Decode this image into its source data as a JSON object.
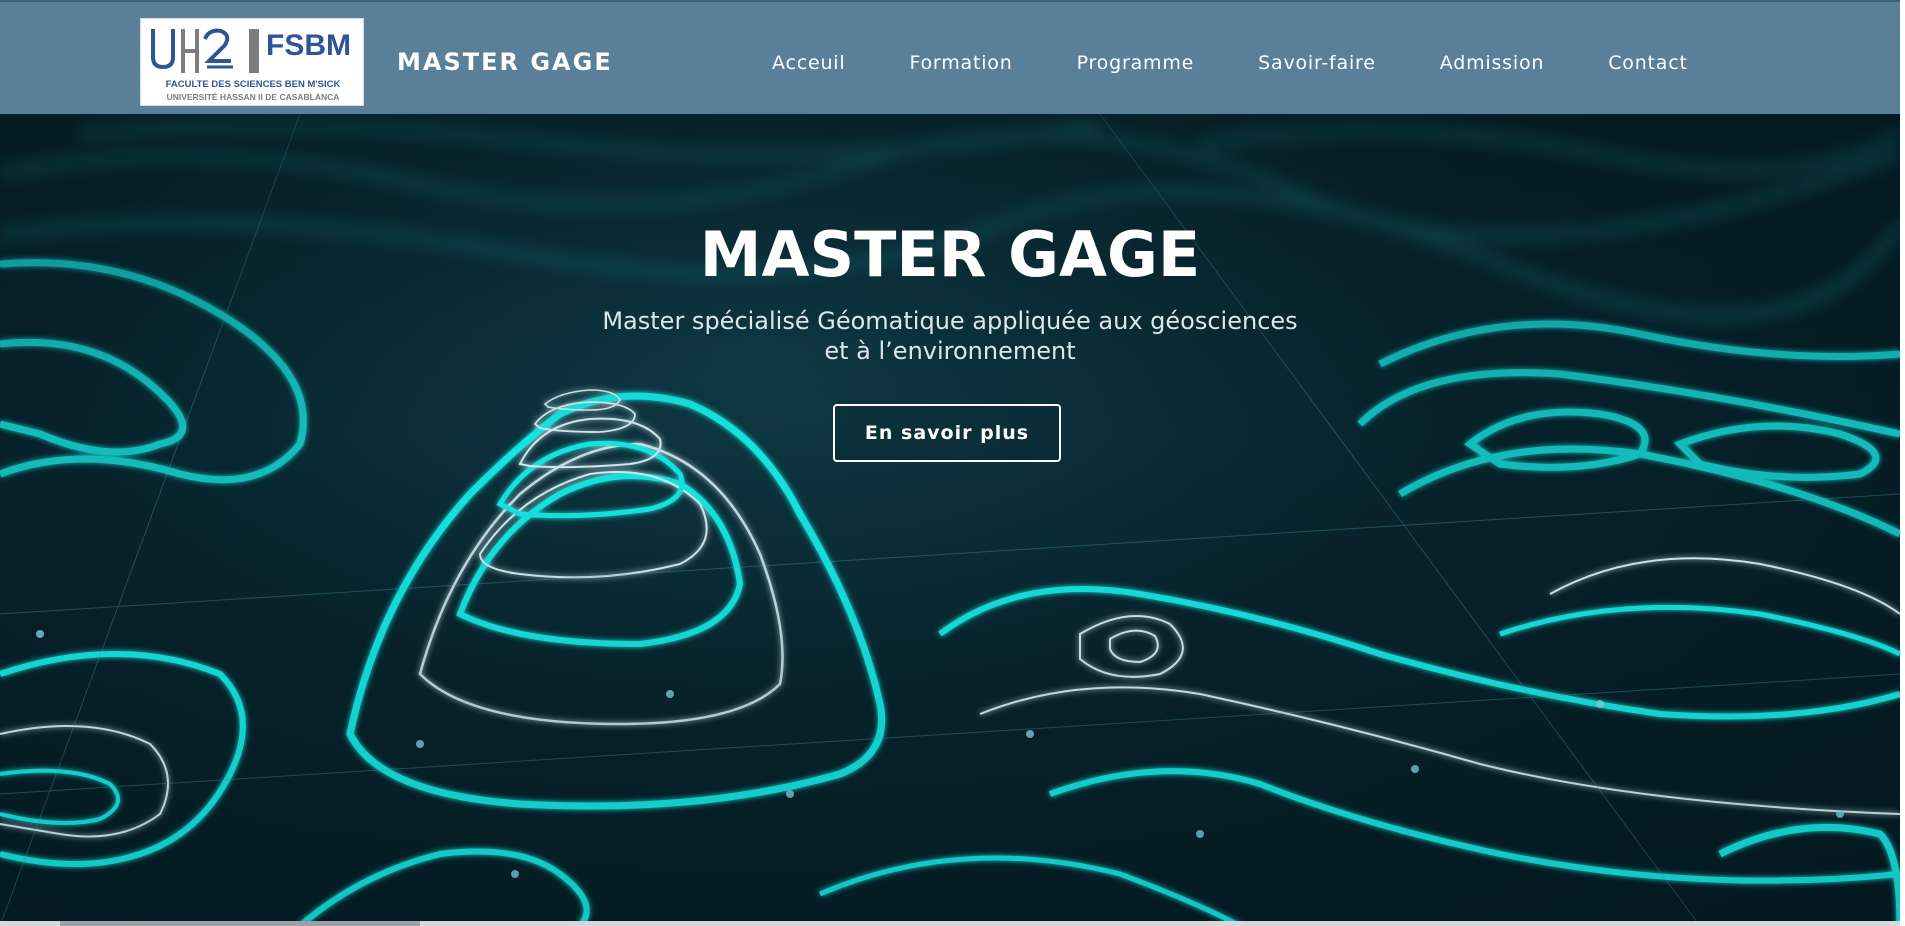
{
  "header": {
    "logo": {
      "acronym": "FSBM",
      "line1": "FACULTE DES SCIENCES BEN M'SICK",
      "line2": "UNIVERSITÉ HASSAN II DE CASABLANCA",
      "mark_text": "UH2"
    },
    "site_title": "MASTER GAGE",
    "nav": {
      "items": [
        {
          "label": "Acceuil"
        },
        {
          "label": "Formation"
        },
        {
          "label": "Programme"
        },
        {
          "label": "Savoir-faire"
        },
        {
          "label": "Admission"
        },
        {
          "label": "Contact"
        }
      ]
    },
    "background_color": "#5a7f99"
  },
  "hero": {
    "title": "MASTER GAGE",
    "subtitle_line1": "Master spécialisé Géomatique appliquée aux géosciences",
    "subtitle_line2": "et à l’environnement",
    "cta_label": "En savoir plus",
    "accent_color": "#19e3e0",
    "background_color": "#062029",
    "image_icon": "topographic-contour-lines"
  }
}
